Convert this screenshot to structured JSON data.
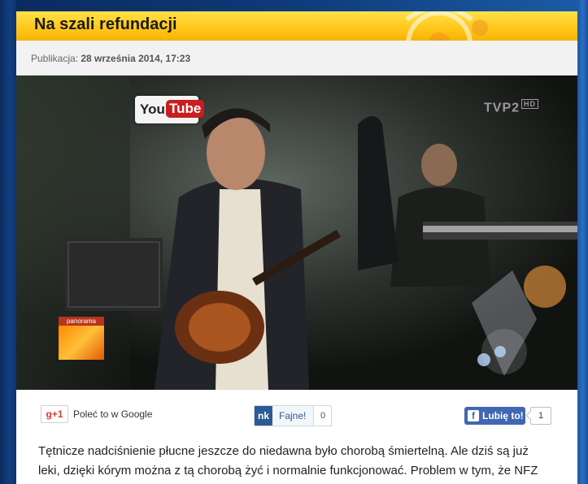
{
  "article": {
    "title": "Na szali refundacji",
    "publication_label": "Publikacja:",
    "publication_date": "28 września 2014, 17:23",
    "body_line1": "Tętnicze nadciśnienie płucne jeszcze do niedawna było chorobą śmiertelną. Ale dziś są już",
    "body_line2": "leki, dzięki kórym można z tą chorobą żyć i normalnie funkcjonować. Problem w tym, że NFZ"
  },
  "video": {
    "yt_you": "You",
    "yt_tube": "Tube",
    "tvp_logo": "TVP2",
    "tvp_hd": "HD",
    "panorama_label": "panorama"
  },
  "social": {
    "gplus_label": "g+1",
    "gplus_text": "Poleć to w Google",
    "nk_logo": "nk",
    "nk_label": "Fajne!",
    "nk_count": "0",
    "fb_icon": "f",
    "fb_label": "Lubię to!",
    "fb_count": "1"
  },
  "colors": {
    "header_yellow": "#ffc81c",
    "facebook_blue": "#4267b2",
    "nk_blue": "#2d5a95",
    "gplus_red": "#d73d32",
    "page_blue": "#0b2f6a"
  }
}
